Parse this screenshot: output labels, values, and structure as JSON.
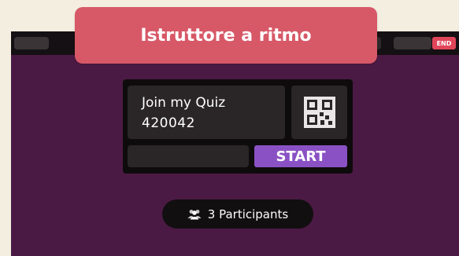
{
  "banner": {
    "title": "Istruttore a ritmo"
  },
  "topbar": {
    "end_label": "END"
  },
  "join": {
    "label": "Join my Quiz",
    "code": "420042",
    "qr_icon": "qr-code-icon",
    "name_placeholder": "",
    "start_label": "START"
  },
  "participants": {
    "icon": "users-icon",
    "label": "3 Participants"
  },
  "colors": {
    "page_bg": "#f3eee0",
    "app_bg": "#4b1a44",
    "banner": "#d75867",
    "start": "#8a51c4",
    "end": "#e0465a"
  }
}
